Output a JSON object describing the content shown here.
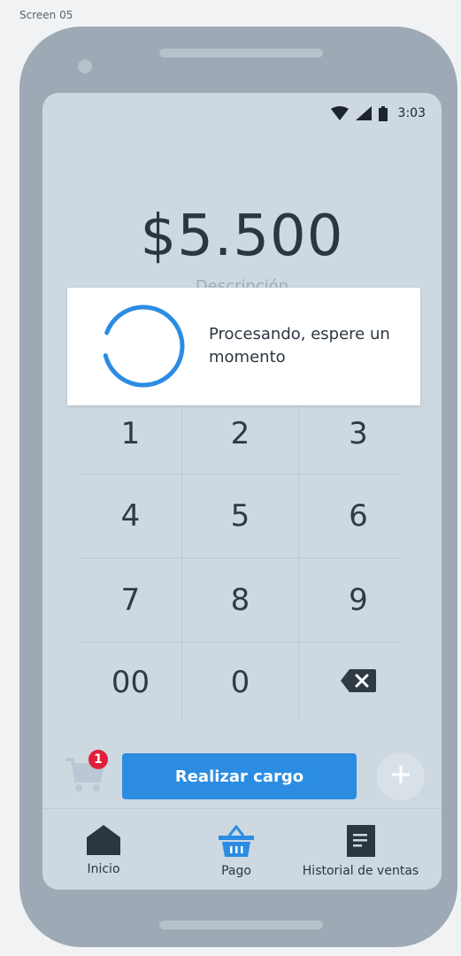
{
  "screen_label": "Screen 05",
  "status_bar": {
    "time": "3:03",
    "icons": [
      "wifi-icon",
      "signal-icon",
      "battery-icon"
    ]
  },
  "payment": {
    "amount": "$5.500",
    "description_placeholder": "Descripción"
  },
  "dialog": {
    "message": "Procesando, espere un momento"
  },
  "keypad": {
    "keys": [
      "1",
      "2",
      "3",
      "4",
      "5",
      "6",
      "7",
      "8",
      "9",
      "00",
      "0"
    ],
    "backspace_icon": "backspace-icon"
  },
  "cart": {
    "icon": "cart-icon",
    "badge_count": "1"
  },
  "actions": {
    "charge_label": "Realizar cargo",
    "add_icon": "plus-icon"
  },
  "nav": {
    "items": [
      {
        "label": "Inicio",
        "icon": "home-icon"
      },
      {
        "label": "Pago",
        "icon": "basket-icon"
      },
      {
        "label": "Historial de ventas",
        "icon": "document-icon"
      }
    ]
  },
  "colors": {
    "accent": "#2b8ce2",
    "badge": "#e0203a",
    "screen_bg": "#cdd8e1",
    "frame": "#9da9b5",
    "spinner": "#2b8ce2"
  }
}
